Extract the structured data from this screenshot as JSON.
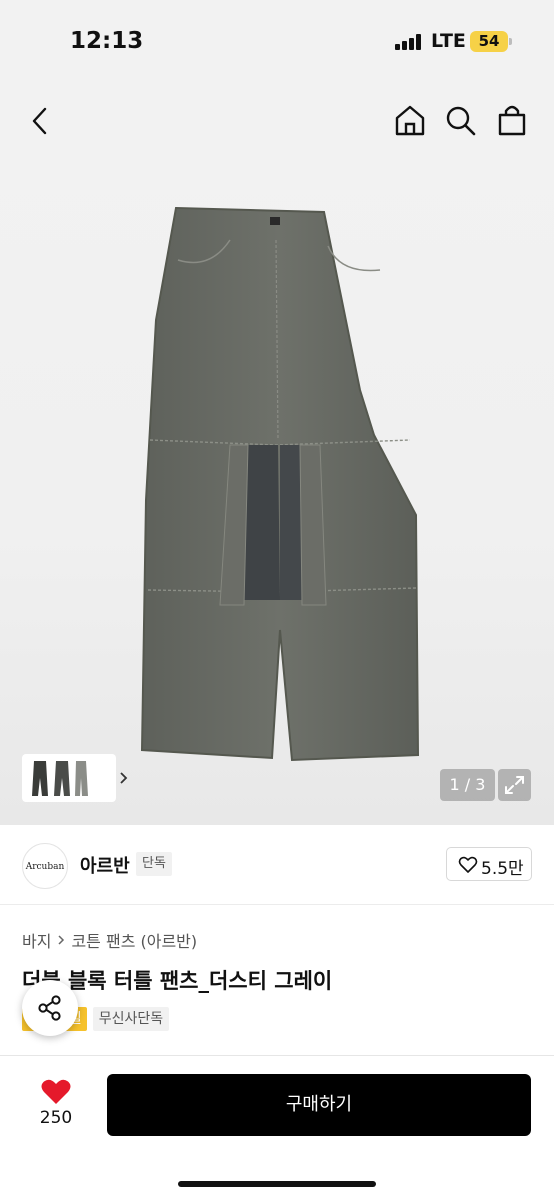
{
  "status_bar": {
    "time": "12:13",
    "network": "LTE",
    "battery": "54"
  },
  "icons": {
    "back": "chevron-left-icon",
    "home": "home-icon",
    "search": "search-icon",
    "cart": "shopping-bag-icon",
    "share": "share-icon",
    "wish": "heart-icon"
  },
  "gallery": {
    "counter": "1 / 3",
    "current": 1,
    "total": 3
  },
  "brand": {
    "logo_text": "Arcuban",
    "name": "아르반",
    "badge": "단독",
    "likes": "5.5만"
  },
  "breadcrumb": [
    "바지",
    "코튼 팬츠 (아르반)"
  ],
  "product": {
    "title": "더블 블록 터틀 팬츠_더스티 그레이",
    "tags": [
      "세일",
      "무신사단독"
    ]
  },
  "bottom": {
    "wish_count": "250",
    "buy_label": "구매하기"
  },
  "colors": {
    "accent_sale": "#f6c22c",
    "buy_button": "#000000",
    "heart": "#e5192b",
    "battery": "#f6d147"
  }
}
